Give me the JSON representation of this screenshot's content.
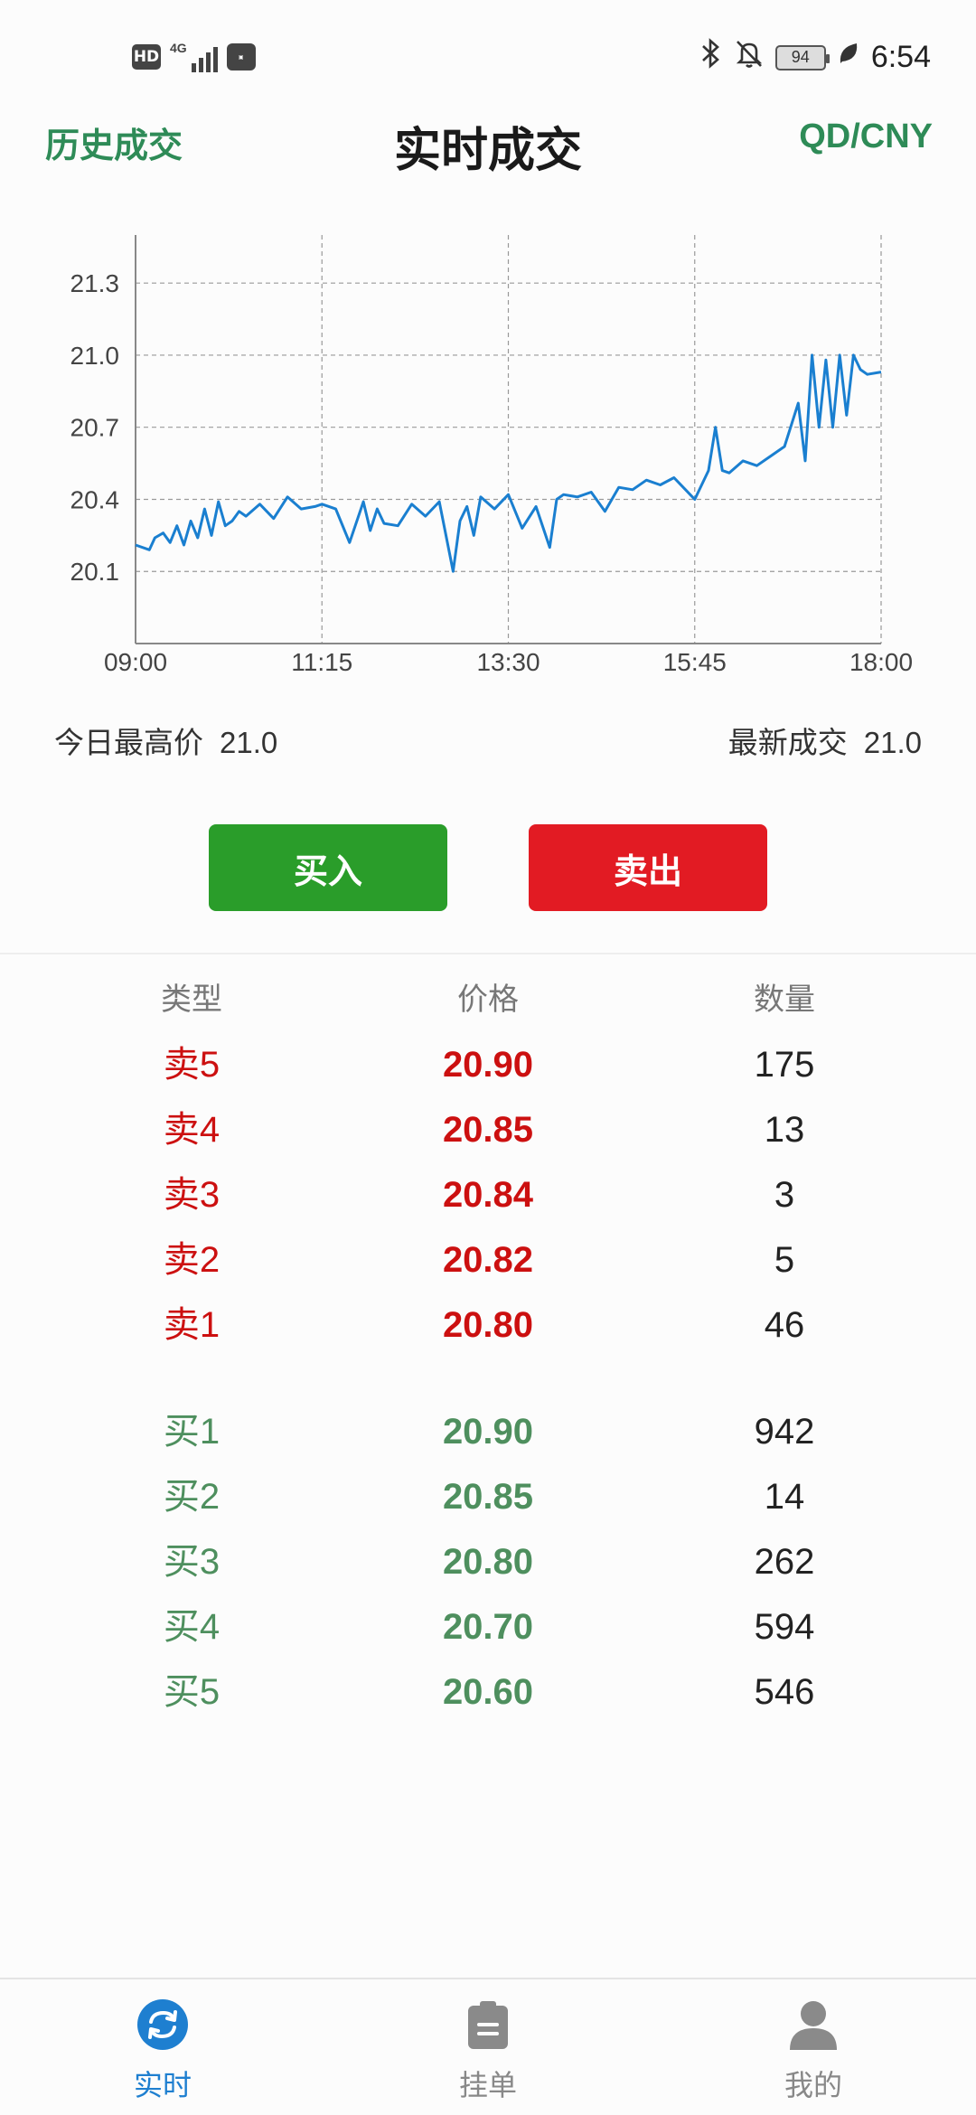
{
  "status_bar": {
    "hd": "HD",
    "network": "4G",
    "battery": "94",
    "time": "6:54"
  },
  "header": {
    "left_link": "历史成交",
    "title": "实时成交",
    "right_link": "QD/CNY"
  },
  "chart_data": {
    "type": "line",
    "x_ticks": [
      "09:00",
      "11:15",
      "13:30",
      "15:45",
      "18:00"
    ],
    "y_ticks": [
      "20.1",
      "20.4",
      "20.7",
      "21.0",
      "21.3"
    ],
    "ylim": [
      19.8,
      21.5
    ],
    "grid": true,
    "color": "#1a7fd0",
    "series": [
      {
        "x": [
          "09:00",
          "09:10",
          "09:14",
          "09:20",
          "09:25",
          "09:30",
          "09:35",
          "09:40",
          "09:45",
          "09:50",
          "09:55",
          "10:00",
          "10:05",
          "10:10",
          "10:15",
          "10:20",
          "10:30",
          "10:40",
          "10:50",
          "11:00",
          "11:10",
          "11:15",
          "11:25",
          "11:35",
          "11:45",
          "11:50",
          "11:55",
          "12:00",
          "12:10",
          "12:20",
          "12:30",
          "12:40",
          "12:50",
          "12:55",
          "13:00",
          "13:05",
          "13:10",
          "13:20",
          "13:30",
          "13:40",
          "13:50",
          "14:00",
          "14:05",
          "14:10",
          "14:20",
          "14:30",
          "14:40",
          "14:50",
          "15:00",
          "15:10",
          "15:20",
          "15:30",
          "15:45",
          "15:55",
          "16:00",
          "16:05",
          "16:10",
          "16:20",
          "16:30",
          "16:40",
          "16:50",
          "17:00",
          "17:05",
          "17:10",
          "17:15",
          "17:20",
          "17:25",
          "17:30",
          "17:35",
          "17:40",
          "17:45",
          "17:50",
          "18:00"
        ],
        "y": [
          20.21,
          20.19,
          20.24,
          20.26,
          20.22,
          20.29,
          20.21,
          20.31,
          20.24,
          20.36,
          20.25,
          20.39,
          20.29,
          20.31,
          20.35,
          20.33,
          20.38,
          20.32,
          20.41,
          20.36,
          20.37,
          20.38,
          20.36,
          20.22,
          20.39,
          20.27,
          20.36,
          20.3,
          20.29,
          20.38,
          20.33,
          20.39,
          20.1,
          20.31,
          20.37,
          20.25,
          20.41,
          20.36,
          20.42,
          20.28,
          20.37,
          20.2,
          20.4,
          20.42,
          20.41,
          20.43,
          20.35,
          20.45,
          20.44,
          20.48,
          20.46,
          20.49,
          20.4,
          20.52,
          20.7,
          20.52,
          20.51,
          20.56,
          20.54,
          20.58,
          20.62,
          20.8,
          20.56,
          21.0,
          20.7,
          20.98,
          20.7,
          21.0,
          20.75,
          21.0,
          20.94,
          20.92,
          20.93
        ]
      }
    ]
  },
  "stats": {
    "high_label": "今日最高价",
    "high_value": "21.0",
    "last_label": "最新成交",
    "last_value": "21.0"
  },
  "actions": {
    "buy": "买入",
    "sell": "卖出"
  },
  "order_book": {
    "headers": [
      "类型",
      "价格",
      "数量"
    ],
    "sells": [
      {
        "type": "卖5",
        "price": "20.90",
        "qty": "175"
      },
      {
        "type": "卖4",
        "price": "20.85",
        "qty": "13"
      },
      {
        "type": "卖3",
        "price": "20.84",
        "qty": "3"
      },
      {
        "type": "卖2",
        "price": "20.82",
        "qty": "5"
      },
      {
        "type": "卖1",
        "price": "20.80",
        "qty": "46"
      }
    ],
    "buys": [
      {
        "type": "买1",
        "price": "20.90",
        "qty": "942"
      },
      {
        "type": "买2",
        "price": "20.85",
        "qty": "14"
      },
      {
        "type": "买3",
        "price": "20.80",
        "qty": "262"
      },
      {
        "type": "买4",
        "price": "20.70",
        "qty": "594"
      },
      {
        "type": "买5",
        "price": "20.60",
        "qty": "546"
      }
    ]
  },
  "bottom_nav": {
    "items": [
      {
        "label": "实时",
        "icon": "refresh-icon",
        "active": true
      },
      {
        "label": "挂单",
        "icon": "clipboard-icon",
        "active": false
      },
      {
        "label": "我的",
        "icon": "user-icon",
        "active": false
      }
    ]
  }
}
